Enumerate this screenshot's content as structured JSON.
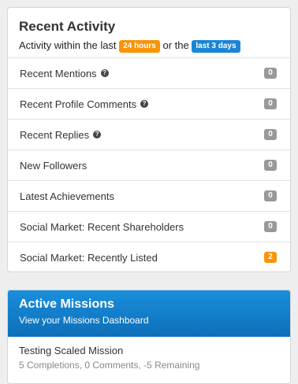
{
  "activity": {
    "title": "Recent Activity",
    "sub_prefix": "Activity within the last",
    "chip_24h": "24 hours",
    "sub_middle": "or the",
    "chip_3d": "last 3 days",
    "items": [
      {
        "label": "Recent Mentions",
        "count": "0",
        "help": true
      },
      {
        "label": "Recent Profile Comments",
        "count": "0",
        "help": true
      },
      {
        "label": "Recent Replies",
        "count": "0",
        "help": true
      },
      {
        "label": "New Followers",
        "count": "0",
        "help": false
      },
      {
        "label": "Latest Achievements",
        "count": "0",
        "help": false
      },
      {
        "label": "Social Market: Recent Shareholders",
        "count": "0",
        "help": false
      },
      {
        "label": "Social Market: Recently Listed",
        "count": "2",
        "help": false
      }
    ]
  },
  "missions": {
    "title": "Active Missions",
    "dashboard_link": "View your Missions Dashboard",
    "items": [
      {
        "name": "Testing Scaled Mission",
        "stats": "5 Completions, 0 Comments, -5 Remaining"
      }
    ]
  },
  "colors": {
    "badge_default": "#999999",
    "badge_highlight": "#f89406",
    "chip_orange": "#f89406",
    "chip_blue": "#1a85d6",
    "missions_header": "#1a8fdc"
  },
  "help_icon": "question-circle-icon"
}
